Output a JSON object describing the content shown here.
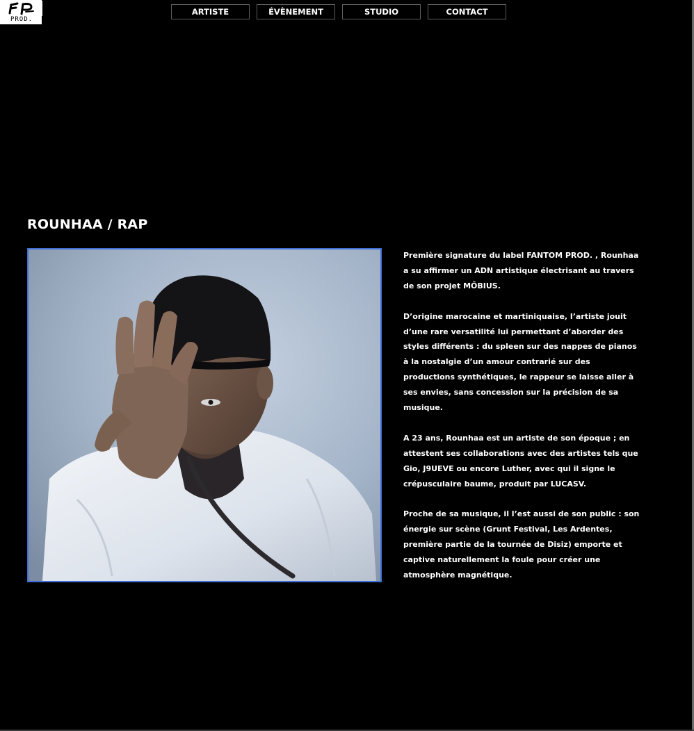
{
  "logo": {
    "mark": "FP",
    "sub": "PROD."
  },
  "nav": {
    "items": [
      "ARTISTE",
      "ÉVÈNEMENT",
      "STUDIO",
      "CONTACT"
    ]
  },
  "artist": {
    "title": "ROUNHAA / RAP",
    "bio": [
      "Première signature du label FANTOM PROD. , Rounhaa a su affirmer un ADN artistique électrisant au travers de son projet MÖBIUS.",
      "D’origine marocaine et martiniquaise, l’artiste jouit d’une rare versatilité lui permettant d’aborder des styles différents : du spleen sur des nappes de pianos à la nostalgie d’un amour contrarié sur des productions synthétiques, le rappeur se laisse aller à ses envies, sans concession sur la précision de sa musique.",
      "A 23 ans, Rounhaa est un artiste de son époque ; en attestent ses collaborations avec des artistes tels que Gio, J9UEVE ou encore Luther, avec qui il signe le crépusculaire baume, produit par LUCASV.",
      "Proche de sa musique, il l’est aussi de son public : son énergie sur scène (Grunt Festival, Les Ardentes, première partie de la tournée de Disiz) emporte et captive naturellement la foule pour créer une atmosphère magnétique."
    ]
  },
  "colors": {
    "background": "#000000",
    "text": "#ffffff",
    "nav_border": "#5e5e5e",
    "photo_border": "#3f6fd6",
    "photo_backdrop": "#9fb0c6"
  }
}
